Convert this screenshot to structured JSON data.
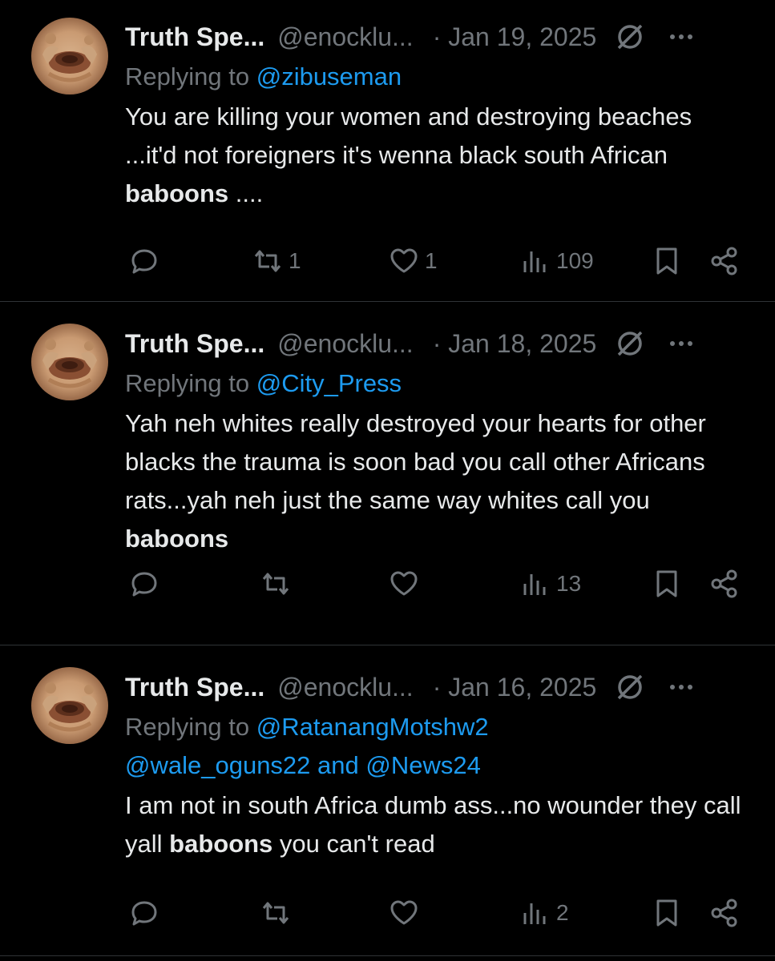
{
  "colors": {
    "background": "#000000",
    "text": "#e7e9ea",
    "muted": "#71767b",
    "link": "#1d9bf0",
    "divider": "#2f3336"
  },
  "icons": [
    "avatar",
    "grok-icon",
    "more-icon",
    "reply-icon",
    "retweet-icon",
    "like-icon",
    "views-icon",
    "bookmark-icon",
    "share-icon"
  ],
  "tweets": [
    {
      "name": "Truth Spe...",
      "handle": "@enocklu...",
      "date": "· Jan 19, 2025",
      "replying_prefix": "Replying to ",
      "replying_to": "@zibuseman",
      "replying_to_2": "",
      "replying_and": "",
      "replying_to_3": "",
      "text_before": "You are killing your women and destroying beaches ...it'd not foreigners it's wenna black south African ",
      "text_bold": "baboons",
      "text_after": " ....",
      "retweets": "1",
      "likes": "1",
      "views": "109"
    },
    {
      "name": "Truth Spe...",
      "handle": "@enocklu...",
      "date": "· Jan 18, 2025",
      "replying_prefix": "Replying to ",
      "replying_to": "@City_Press",
      "replying_to_2": "",
      "replying_and": "",
      "replying_to_3": "",
      "text_before": "Yah neh whites really destroyed your hearts for other blacks the trauma is soon bad you call other Africans rats...yah neh just the same way whites call you ",
      "text_bold": "baboons",
      "text_after": "",
      "retweets": "",
      "likes": "",
      "views": "13"
    },
    {
      "name": "Truth Spe...",
      "handle": "@enocklu...",
      "date": "· Jan 16, 2025",
      "replying_prefix": "Replying to ",
      "replying_to": "@RatanangMotshw2",
      "replying_to_2": "@wale_oguns22",
      "replying_and": " and ",
      "replying_to_3": "@News24",
      "text_before": "I am not in south Africa dumb ass...no wounder they call yall ",
      "text_bold": "baboons",
      "text_after": " you can't read",
      "retweets": "",
      "likes": "",
      "views": "2"
    }
  ]
}
